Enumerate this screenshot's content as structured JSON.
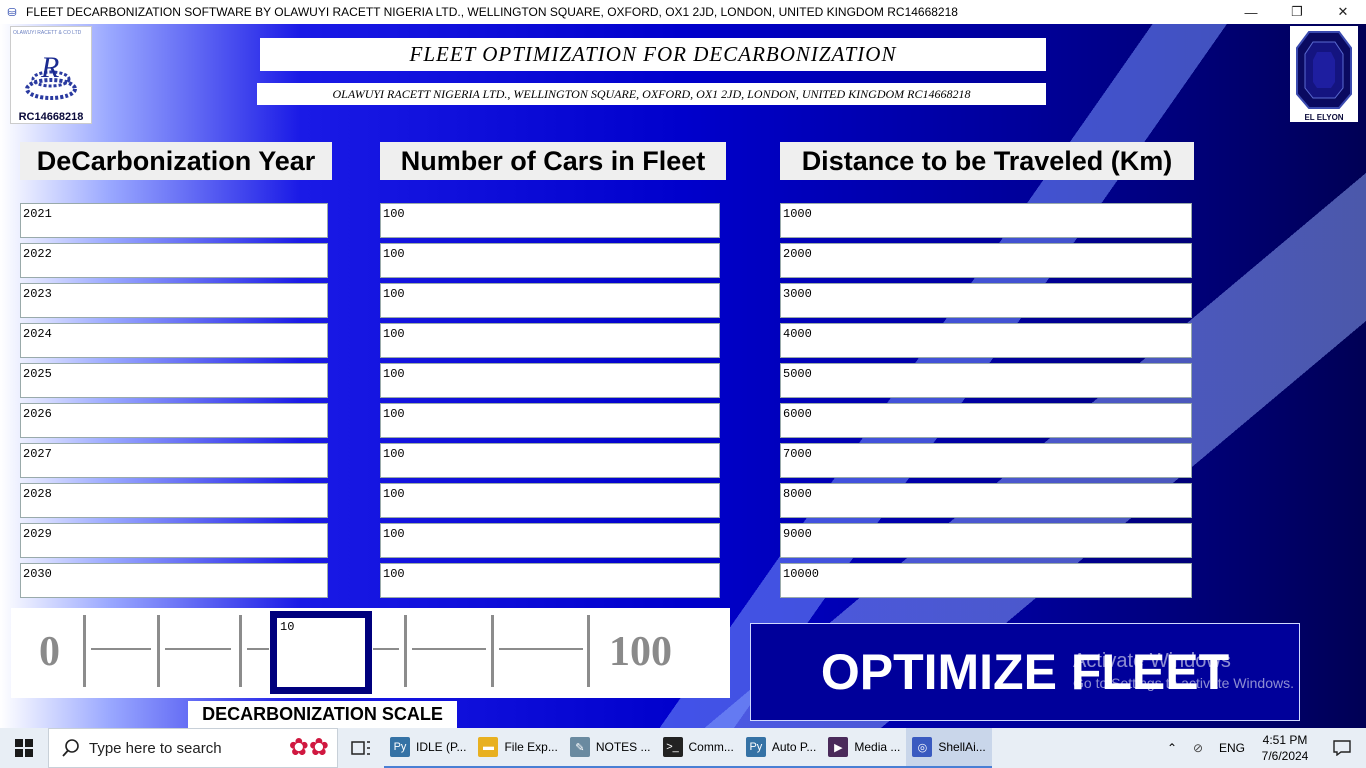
{
  "window": {
    "title": "FLEET DECARBONIZATION SOFTWARE BY OLAWUYI RACETT NIGERIA LTD., WELLINGTON SQUARE, OXFORD, OX1 2JD, LONDON, UNITED KINGDOM RC14668218",
    "minimize": "—",
    "maximize": "❐",
    "close": "✕"
  },
  "header": {
    "main_title": "FLEET OPTIMIZATION FOR DECARBONIZATION",
    "sub_title": "OLAWUYI RACETT NIGERIA LTD., WELLINGTON SQUARE, OXFORD, OX1 2JD, LONDON, UNITED KINGDOM RC14668218",
    "left_logo_text": "OLAWUYI RACETT & CO LTD",
    "left_logo_label": "RC14668218",
    "right_logo_label": "EL ELYON"
  },
  "columns": {
    "year_header": "DeCarbonization Year",
    "cars_header": "Number of Cars in Fleet",
    "distance_header": "Distance to be Traveled (Km)"
  },
  "rows": [
    {
      "year": "2021",
      "cars": "100",
      "distance": "1000"
    },
    {
      "year": "2022",
      "cars": "100",
      "distance": "2000"
    },
    {
      "year": "2023",
      "cars": "100",
      "distance": "3000"
    },
    {
      "year": "2024",
      "cars": "100",
      "distance": "4000"
    },
    {
      "year": "2025",
      "cars": "100",
      "distance": "5000"
    },
    {
      "year": "2026",
      "cars": "100",
      "distance": "6000"
    },
    {
      "year": "2027",
      "cars": "100",
      "distance": "7000"
    },
    {
      "year": "2028",
      "cars": "100",
      "distance": "8000"
    },
    {
      "year": "2029",
      "cars": "100",
      "distance": "9000"
    },
    {
      "year": "2030",
      "cars": "100",
      "distance": "10000"
    }
  ],
  "scale": {
    "min_label": "0",
    "max_label": "100",
    "value": "10",
    "caption": "DECARBONIZATION SCALE"
  },
  "optimize_button": "OPTIMIZE FLEET",
  "watermark": {
    "line1": "Activate Windows",
    "line2": "Go to Settings to activate Windows."
  },
  "taskbar": {
    "search_placeholder": "Type here to search",
    "apps": [
      {
        "label": "IDLE (P...",
        "icon": "python-idle-icon",
        "color": "#3572a5"
      },
      {
        "label": "File Exp...",
        "icon": "folder-icon",
        "color": "#e8b020"
      },
      {
        "label": "NOTES ...",
        "icon": "notes-icon",
        "color": "#6a8aa0"
      },
      {
        "label": "Comm...",
        "icon": "terminal-icon",
        "color": "#222222"
      },
      {
        "label": "Auto P...",
        "icon": "python-icon",
        "color": "#3572a5"
      },
      {
        "label": "Media ...",
        "icon": "media-player-icon",
        "color": "#4a2a5a"
      },
      {
        "label": "ShellAi...",
        "icon": "shellai-icon",
        "color": "#3a5ac0"
      }
    ],
    "lang": "ENG",
    "time": "4:51 PM",
    "date": "7/6/2024"
  }
}
